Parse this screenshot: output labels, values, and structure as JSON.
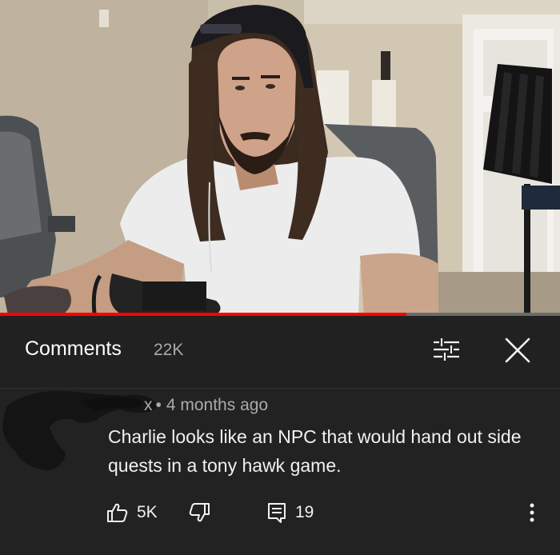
{
  "video": {
    "progress_fraction": 0.725
  },
  "comments_panel": {
    "title": "Comments",
    "count": "22K"
  },
  "comment": {
    "author_suffix": "x",
    "separator": "•",
    "time_ago": "4 months ago",
    "text": "Charlie looks like an NPC that would hand out side quests in a tony hawk game.",
    "likes": "5K",
    "replies": "19"
  },
  "icons": {
    "filter": "sliders-icon",
    "close": "close-icon",
    "like": "thumbs-up-icon",
    "dislike": "thumbs-down-icon",
    "reply": "reply-icon",
    "more": "more-vertical-icon"
  },
  "colors": {
    "background": "#212121",
    "progress": "#ff0000",
    "secondary_text": "#aaaaaa",
    "primary_text": "#f1f1f1"
  }
}
